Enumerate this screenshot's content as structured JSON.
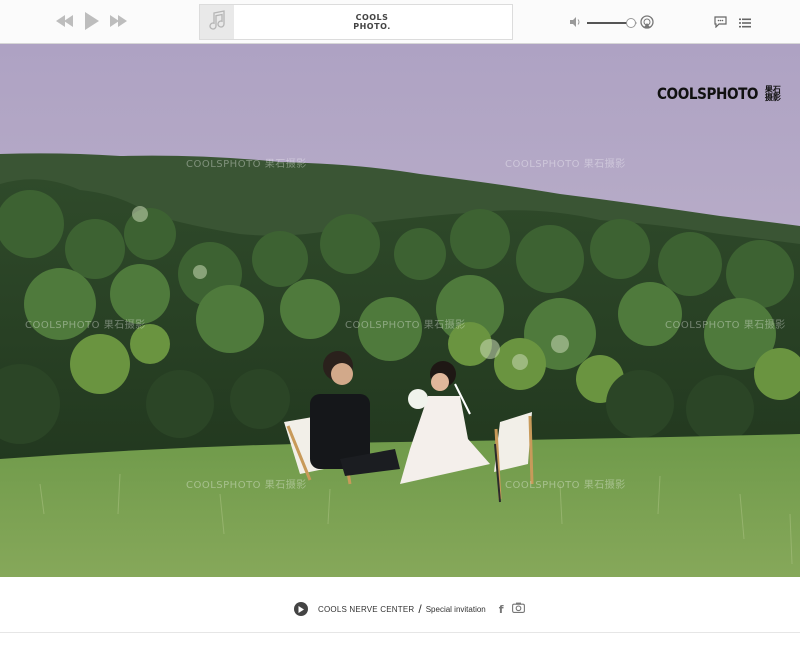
{
  "player": {
    "controls": {
      "rewind": "rewind-icon",
      "play": "play-icon",
      "forward": "fast-forward-icon"
    },
    "now_playing": {
      "art_icon": "music-note-icon",
      "logo_line1": "COOLS",
      "logo_line2": "PHOTO."
    },
    "volume_level": 0.88,
    "volume_icon": "speaker-icon",
    "airplay_icon": "airplay-icon",
    "comment_icon": "comment-icon",
    "playlist_icon": "playlist-icon"
  },
  "photo": {
    "brand_main": "COOLSPHOTO",
    "brand_cn_line1": "果石",
    "brand_cn_line2": "摄影",
    "watermark": "COOLSPHOTO 果石摄影"
  },
  "footer": {
    "center_label": "COOLS NERVE CENTER",
    "separator": "/",
    "invite_label": "Special invitation",
    "facebook_glyph": "f",
    "camera_icon": "camera-icon"
  },
  "colors": {
    "bar_bg": "#fbfbfb",
    "accent": "#444444",
    "sky": "#b1a6c3",
    "grass": "#6f9a4c"
  }
}
